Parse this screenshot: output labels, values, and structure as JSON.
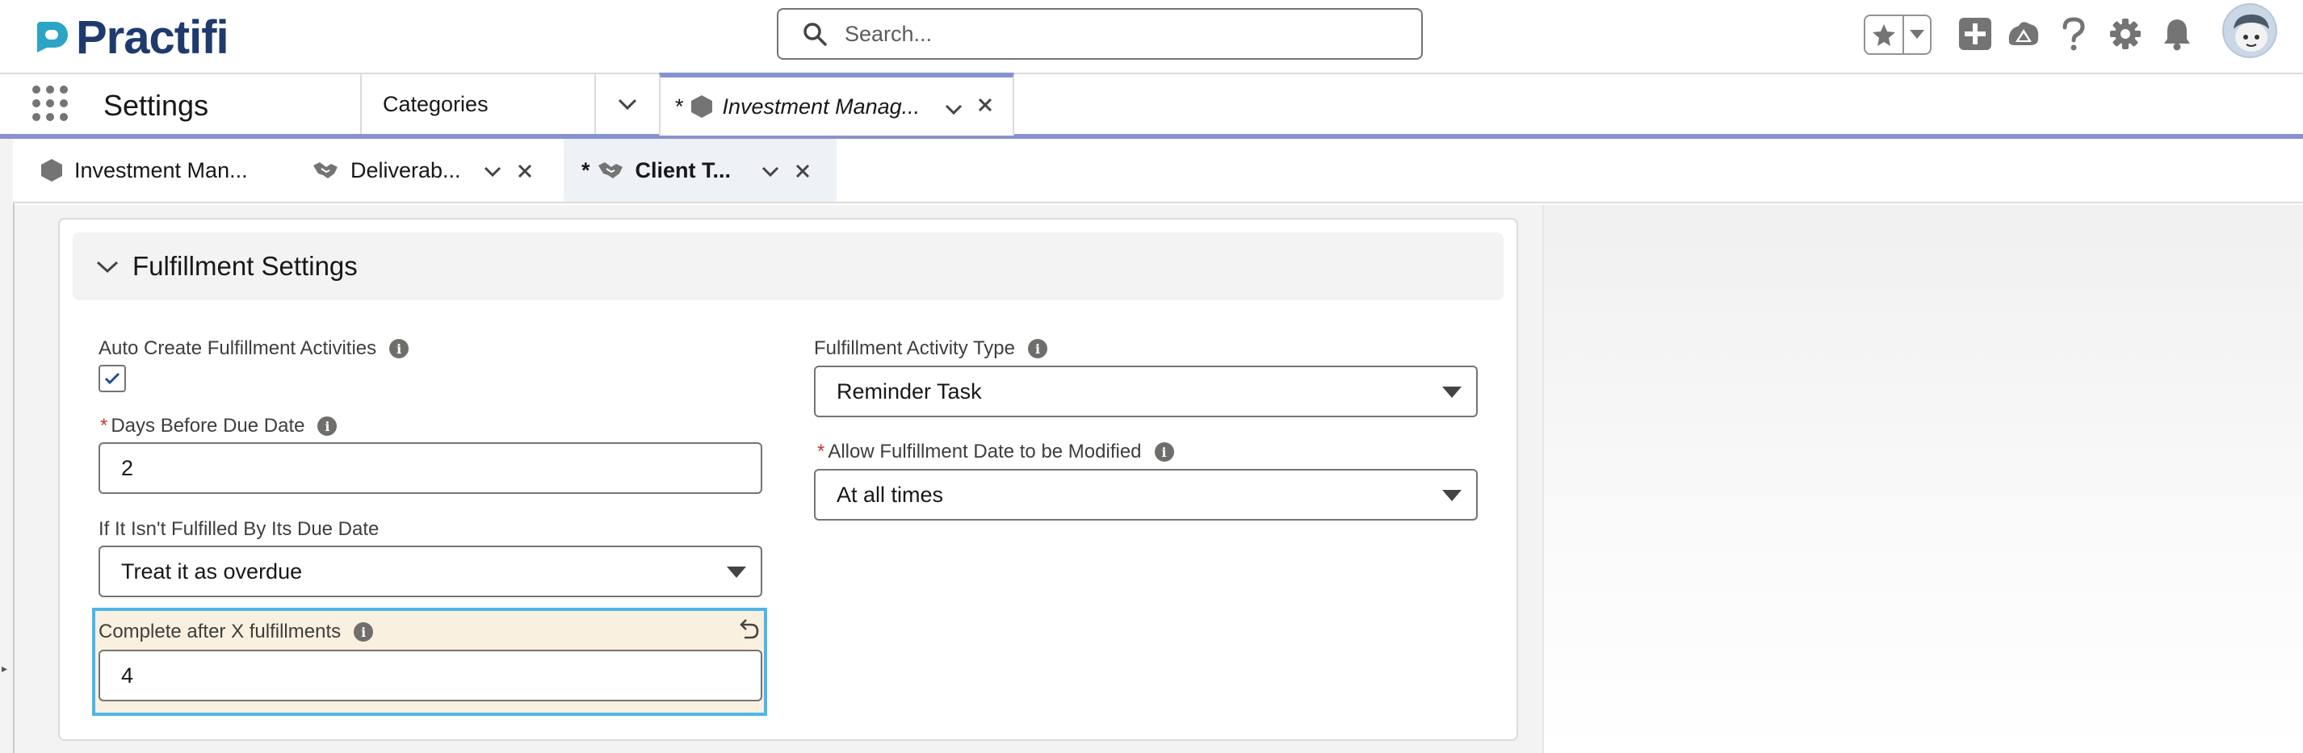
{
  "header": {
    "logo_text": "Practifi",
    "search_placeholder": "Search...",
    "icons": [
      "favorites-star-icon",
      "favorites-dropdown-icon",
      "add-icon",
      "trailhead-icon",
      "help-icon",
      "setup-gear-icon",
      "notifications-bell-icon",
      "user-avatar"
    ]
  },
  "navbar": {
    "app_name": "Settings",
    "categories_label": "Categories",
    "tab": {
      "modified_mark": "*",
      "label": "Investment Manag..."
    }
  },
  "subtabs": [
    {
      "label": "Investment Man...",
      "icon": "hexagon-icon",
      "modified": ""
    },
    {
      "label": "Deliverab...",
      "icon": "handshake-icon",
      "modified": ""
    },
    {
      "label": "Client T...",
      "icon": "handshake-icon",
      "modified": "*"
    }
  ],
  "section": {
    "title": "Fulfillment Settings"
  },
  "fields": {
    "auto_create": {
      "label": "Auto Create Fulfillment Activities",
      "checked": true
    },
    "days_before": {
      "label": "Days Before Due Date",
      "value": "2",
      "required": "*"
    },
    "not_fulfilled": {
      "label": "If It Isn't Fulfilled By Its Due Date",
      "value": "Treat it as overdue"
    },
    "complete_after": {
      "label": "Complete after X fulfillments",
      "value": "4"
    },
    "activity_type": {
      "label": "Fulfillment Activity Type",
      "value": "Reminder Task"
    },
    "allow_modified": {
      "label": "Allow Fulfillment Date to be Modified",
      "value": "At all times",
      "required": "*"
    }
  },
  "colors": {
    "accent": "#8792cf",
    "brand": "#1f3a6e",
    "logo_teal": "#2ba4c6",
    "focus_border": "#4db6e8",
    "modified_bg": "#faf0e0",
    "required": "#c23934"
  }
}
